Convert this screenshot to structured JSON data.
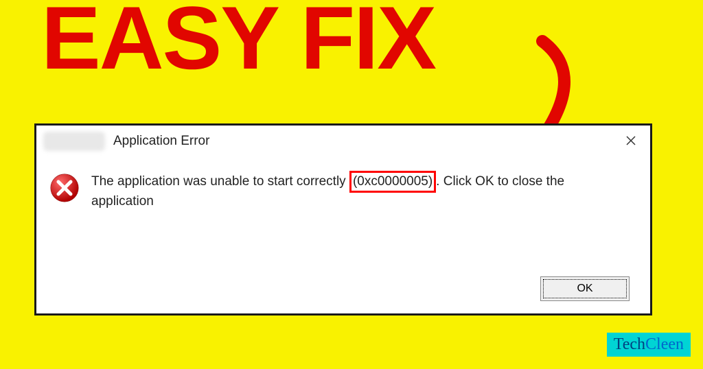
{
  "headline": "EASY FIX",
  "dialog": {
    "title": "Application Error",
    "message_part1": "The application was unable to start correctly ",
    "error_code": "(0xc0000005)",
    "message_part2": ". Click OK to close the application",
    "ok_label": "OK"
  },
  "watermark": {
    "part1": "Tech",
    "part2": "Cleen"
  },
  "colors": {
    "background": "#f9f200",
    "accent_red": "#e10600",
    "highlight_red": "#ff0000",
    "watermark_bg": "#00d4d4"
  }
}
